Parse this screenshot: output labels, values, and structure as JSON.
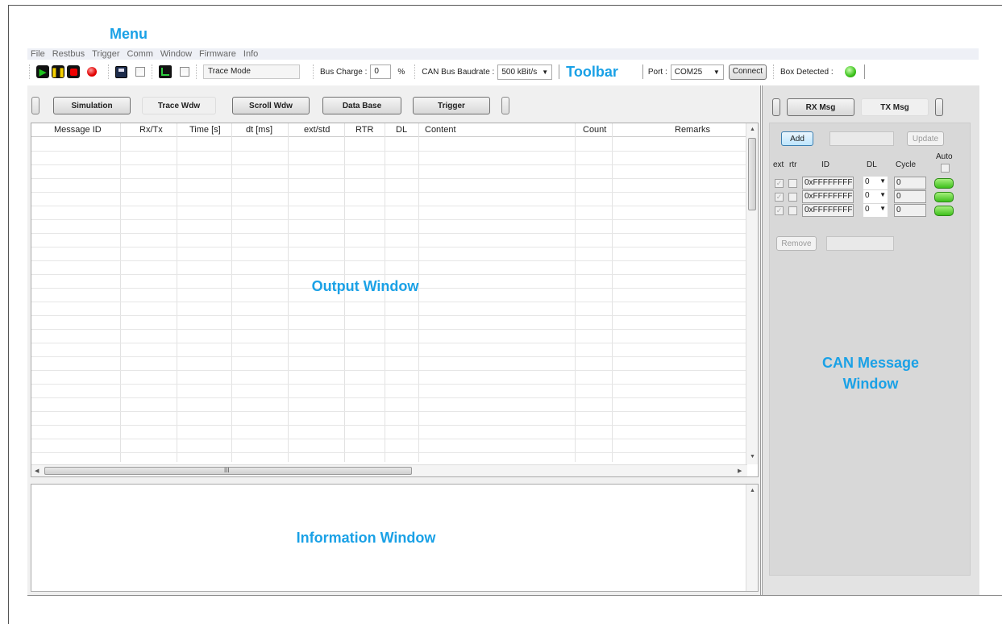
{
  "callouts": {
    "menu": "Menu",
    "toolbar": "Toolbar",
    "output": "Output Window",
    "information": "Information Window",
    "can_line1": "CAN Message",
    "can_line2": "Window"
  },
  "menu": [
    "File",
    "Restbus",
    "Trigger",
    "Comm",
    "Window",
    "Firmware",
    "Info"
  ],
  "toolbar": {
    "trace_mode": "Trace Mode",
    "bus_charge_label": "Bus Charge :",
    "bus_charge_value": "0",
    "bus_charge_unit": "%",
    "baudrate_label": "CAN Bus Baudrate :",
    "baudrate_value": "500 kBit/s",
    "port_label": "Port :",
    "port_value": "COM25",
    "connect": "Connect",
    "box_detected": "Box Detected :"
  },
  "tabs": [
    "Simulation",
    "Trace Wdw",
    "Scroll Wdw",
    "Data Base",
    "Trigger"
  ],
  "columns": [
    "Message ID",
    "Rx/Tx",
    "Time [s]",
    "dt [ms]",
    "ext/std",
    "RTR",
    "DL",
    "Content",
    "Count",
    "Remarks"
  ],
  "hscroll_grip": "III",
  "right": {
    "rx_tab": "RX Msg",
    "tx_tab": "TX Msg",
    "add": "Add",
    "update": "Update",
    "auto": "Auto",
    "ext": "ext",
    "rtr": "rtr",
    "id": "ID",
    "dl": "DL",
    "cycle": "Cycle",
    "remove": "Remove",
    "rows": [
      {
        "id": "0xFFFFFFFF",
        "dl": "0",
        "cycle": "0"
      },
      {
        "id": "0xFFFFFFFF",
        "dl": "0",
        "cycle": "0"
      },
      {
        "id": "0xFFFFFFFF",
        "dl": "0",
        "cycle": "0"
      }
    ]
  }
}
